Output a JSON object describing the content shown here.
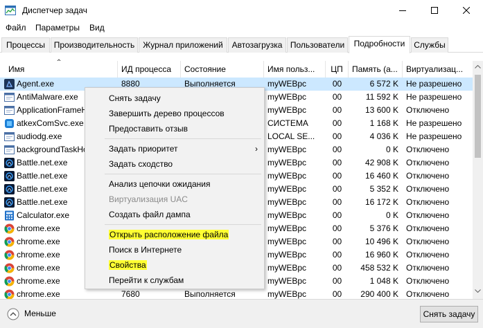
{
  "window": {
    "title": "Диспетчер задач"
  },
  "menu": [
    "Файл",
    "Параметры",
    "Вид"
  ],
  "tabs": [
    {
      "label": "Процессы"
    },
    {
      "label": "Производительность"
    },
    {
      "label": "Журнал приложений"
    },
    {
      "label": "Автозагрузка"
    },
    {
      "label": "Пользователи"
    },
    {
      "label": "Подробности"
    },
    {
      "label": "Службы"
    }
  ],
  "active_tab": "Подробности",
  "columns": [
    "Имя",
    "ИД процесса",
    "Состояние",
    "Имя польз...",
    "ЦП",
    "Память (а...",
    "Виртуализац..."
  ],
  "rows": [
    {
      "name": "Agent.exe",
      "pid": "8880",
      "state": "Выполняется",
      "user": "myWEBpc",
      "cpu": "00",
      "mem": "6 572 K",
      "virt": "Не разрешено",
      "icon": "dark",
      "selected": true
    },
    {
      "name": "AntiMalware.exe",
      "pid": "",
      "state": "",
      "user": "myWEBpc",
      "cpu": "00",
      "mem": "11 592 K",
      "virt": "Не разрешено",
      "icon": "window"
    },
    {
      "name": "ApplicationFrameH",
      "pid": "",
      "state": "",
      "user": "myWEBpc",
      "cpu": "00",
      "mem": "13 600 K",
      "virt": "Отключено",
      "icon": "window"
    },
    {
      "name": "atkexComSvc.exe",
      "pid": "",
      "state": "",
      "user": "СИСТЕМА",
      "cpu": "00",
      "mem": "1 168 K",
      "virt": "Не разрешено",
      "icon": "blue"
    },
    {
      "name": "audiodg.exe",
      "pid": "",
      "state": "",
      "user": "LOCAL SE...",
      "cpu": "00",
      "mem": "4 036 K",
      "virt": "Не разрешено",
      "icon": "window"
    },
    {
      "name": "backgroundTaskHo",
      "pid": "",
      "state": "",
      "user": "myWEBpc",
      "cpu": "00",
      "mem": "0 K",
      "virt": "Отключено",
      "icon": "window"
    },
    {
      "name": "Battle.net.exe",
      "pid": "",
      "state": "",
      "user": "myWEBpc",
      "cpu": "00",
      "mem": "42 908 K",
      "virt": "Отключено",
      "icon": "battle"
    },
    {
      "name": "Battle.net.exe",
      "pid": "",
      "state": "",
      "user": "myWEBpc",
      "cpu": "00",
      "mem": "16 460 K",
      "virt": "Отключено",
      "icon": "battle"
    },
    {
      "name": "Battle.net.exe",
      "pid": "",
      "state": "",
      "user": "myWEBpc",
      "cpu": "00",
      "mem": "5 352 K",
      "virt": "Отключено",
      "icon": "battle"
    },
    {
      "name": "Battle.net.exe",
      "pid": "",
      "state": "",
      "user": "myWEBpc",
      "cpu": "00",
      "mem": "16 172 K",
      "virt": "Отключено",
      "icon": "battle"
    },
    {
      "name": "Calculator.exe",
      "pid": "",
      "state": "",
      "user": "myWEBpc",
      "cpu": "00",
      "mem": "0 K",
      "virt": "Отключено",
      "icon": "calc"
    },
    {
      "name": "chrome.exe",
      "pid": "",
      "state": "",
      "user": "myWEBpc",
      "cpu": "00",
      "mem": "5 376 K",
      "virt": "Отключено",
      "icon": "chrome"
    },
    {
      "name": "chrome.exe",
      "pid": "",
      "state": "",
      "user": "myWEBpc",
      "cpu": "00",
      "mem": "10 496 K",
      "virt": "Отключено",
      "icon": "chrome"
    },
    {
      "name": "chrome.exe",
      "pid": "",
      "state": "",
      "user": "myWEBpc",
      "cpu": "00",
      "mem": "16 960 K",
      "virt": "Отключено",
      "icon": "chrome"
    },
    {
      "name": "chrome.exe",
      "pid": "",
      "state": "",
      "user": "myWEBpc",
      "cpu": "00",
      "mem": "458 532 K",
      "virt": "Отключено",
      "icon": "chrome"
    },
    {
      "name": "chrome.exe",
      "pid": "",
      "state": "",
      "user": "myWEBpc",
      "cpu": "00",
      "mem": "1 048 K",
      "virt": "Отключено",
      "icon": "chrome"
    },
    {
      "name": "chrome.exe",
      "pid": "7680",
      "state": "Выполняется",
      "user": "myWEBpc",
      "cpu": "00",
      "mem": "290 400 K",
      "virt": "Отключено",
      "icon": "chrome"
    }
  ],
  "context_menu": {
    "items": [
      {
        "label": "Снять задачу"
      },
      {
        "label": "Завершить дерево процессов"
      },
      {
        "label": "Предоставить отзыв"
      },
      {
        "label": "Задать приоритет",
        "submenu": true
      },
      {
        "label": "Задать сходство"
      },
      {
        "label": "Анализ цепочки ожидания"
      },
      {
        "label": "Виртуализация UAC",
        "disabled": true
      },
      {
        "label": "Создать файл дампа"
      },
      {
        "label": "Открыть расположение файла",
        "highlighted": true
      },
      {
        "label": "Поиск в Интернете"
      },
      {
        "label": "Свойства",
        "highlighted": true
      },
      {
        "label": "Перейти к службам"
      }
    ],
    "submenu_glyph": "›"
  },
  "footer": {
    "less_label": "Меньше",
    "end_task_label": "Снять задачу"
  },
  "colors": {
    "selected_row": "#cce8ff",
    "highlight": "#ffff33",
    "menu_bg": "#f2f2f2"
  }
}
